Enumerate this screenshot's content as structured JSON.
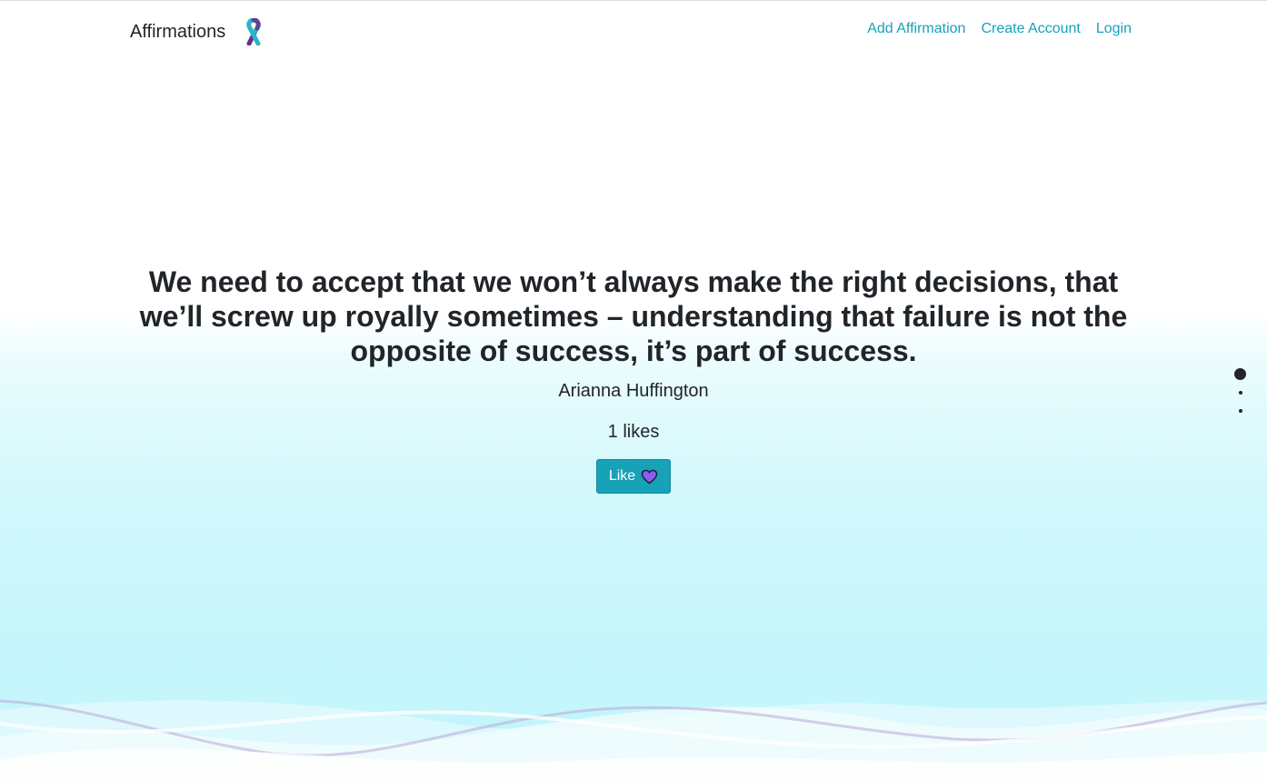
{
  "nav": {
    "brand": "Affirmations",
    "links": [
      "Add Affirmation",
      "Create Account",
      "Login"
    ]
  },
  "affirmation": {
    "quote": "We need to accept that we won’t always make the right decisions, that we’ll screw up royally sometimes – understanding that failure is not the opposite of success, it’s part of success.",
    "author": "Arianna Huffington",
    "likes_text": "1 likes",
    "like_button_label": "Like"
  },
  "carousel": {
    "slide_count": 3,
    "active_index": 0
  },
  "colors": {
    "accent": "#17a2b8",
    "text": "#212529",
    "heart": "#8a5cf5",
    "ribbon_teal": "#29b6c6",
    "ribbon_purple": "#6b2d8c"
  },
  "icons": {
    "brand_icon": "awareness-ribbon-icon",
    "like_icon": "heart-icon"
  }
}
